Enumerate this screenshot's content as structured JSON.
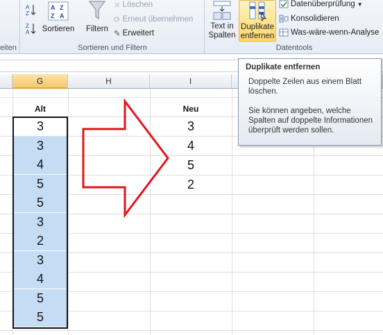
{
  "ribbon": {
    "partial_group_label": "eiten",
    "sort": {
      "az_icon": "sort-az-icon",
      "za_icon": "sort-za-icon",
      "sort_label": "Sortieren",
      "filter_label": "Filtern",
      "clear_label": "Löschen",
      "reapply_label": "Erneut übernehmen",
      "advanced_label": "Erweitert",
      "group_label": "Sortieren und Filtern"
    },
    "data_tools": {
      "text_to_columns_line1": "Text in",
      "text_to_columns_line2": "Spalten",
      "remove_duplicates_line1": "Duplikate",
      "remove_duplicates_line2": "entfernen",
      "data_validation_label": "Datenüberprüfung",
      "consolidate_label": "Konsolidieren",
      "whatif_label": "Was-wäre-wenn-Analyse",
      "group_label": "Datentools"
    }
  },
  "columns": [
    "G",
    "H",
    "I"
  ],
  "sheet": {
    "left_header": "Alt",
    "left_values": [
      "3",
      "3",
      "4",
      "5",
      "5",
      "3",
      "2",
      "3",
      "4",
      "5",
      "5"
    ],
    "right_header": "Neu",
    "right_values": [
      "3",
      "4",
      "5",
      "2"
    ]
  },
  "tooltip": {
    "title": "Duplikate entfernen",
    "para1": "Doppelte Zeilen aus einem Blatt löschen.",
    "para2": "Sie können angeben, welche Spalten auf doppelte Informationen überprüft werden sollen."
  },
  "colors": {
    "arrow": "#e3141b",
    "selection_fill": "#c5dcf5",
    "selected_header": "#f4c973"
  }
}
